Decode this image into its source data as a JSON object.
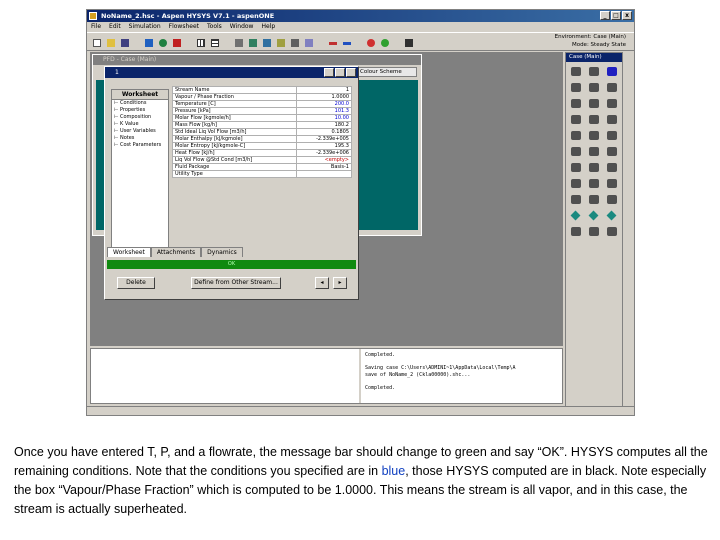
{
  "window": {
    "title": "NoName_2.hsc - Aspen HYSYS V7.1 - aspenONE",
    "controls": [
      "_",
      "□",
      "x"
    ]
  },
  "menu": [
    "File",
    "Edit",
    "Simulation",
    "Flowsheet",
    "Tools",
    "Window",
    "Help"
  ],
  "env_info": {
    "line1": "Environment: Case (Main)",
    "line2": "Mode: Steady State"
  },
  "pfd": {
    "title": "PFD - Case (Main)",
    "color_scheme_button": "Colour Scheme"
  },
  "stream_dialog": {
    "title": "1",
    "side_header": "Worksheet",
    "nav": [
      "Conditions",
      "Properties",
      "Composition",
      "K Value",
      "User Variables",
      "Notes",
      "Cost Parameters"
    ],
    "rows": [
      {
        "label": "Stream Name",
        "value": "1",
        "color": "black"
      },
      {
        "label": "Vapour / Phase Fraction",
        "value": "1.0000",
        "color": "black"
      },
      {
        "label": "Temperature [C]",
        "value": "200.0",
        "color": "blue"
      },
      {
        "label": "Pressure [kPa]",
        "value": "101.3",
        "color": "blue"
      },
      {
        "label": "Molar Flow [kgmole/h]",
        "value": "10.00",
        "color": "blue"
      },
      {
        "label": "Mass Flow [kg/h]",
        "value": "180.2",
        "color": "black"
      },
      {
        "label": "Std Ideal Liq Vol Flow [m3/h]",
        "value": "0.1805",
        "color": "black"
      },
      {
        "label": "Molar Enthalpy [kJ/kgmole]",
        "value": "-2.339e+005",
        "color": "black"
      },
      {
        "label": "Molar Entropy [kJ/kgmole-C]",
        "value": "195.3",
        "color": "black"
      },
      {
        "label": "Heat Flow [kJ/h]",
        "value": "-2.339e+006",
        "color": "black"
      },
      {
        "label": "Liq Vol Flow @Std Cond [m3/h]",
        "value": "<empty>",
        "color": "red"
      },
      {
        "label": "Fluid Package",
        "value": "Basis-1",
        "color": "black"
      },
      {
        "label": "Utility Type",
        "value": "",
        "color": "black"
      }
    ],
    "tabs": [
      "Worksheet",
      "Attachments",
      "Dynamics"
    ],
    "status_message": "OK",
    "buttons": {
      "delete": "Delete",
      "define_from": "Define from Other Stream..."
    }
  },
  "message_panel": {
    "right_text": "Completed.\n\nSaving case C:\\Users\\ADMINI~1\\AppData\\Local\\Temp\\A\nsave of NoName_2 (Ckla00000).shc...\n\nCompleted."
  },
  "palette": {
    "title": "Case (Main)"
  },
  "caption": {
    "part1": "Once you have entered T, P, and a flowrate, the message bar should change to green and say “OK”. HYSYS computes all the remaining conditions. Note that the conditions you specified are in ",
    "blue_word": "blue",
    "part2": ", those HYSYS computed are in black. Note especially the box “Vapour/Phase Fraction” which is computed to be 1.0000. This means the stream is all vapor, and in this case, the stream is actually superheated."
  },
  "colors": {
    "title_blue": "#0a246a",
    "ok_green": "#108a10",
    "pfd_teal": "#006666",
    "specified_blue": "#0000d0"
  }
}
